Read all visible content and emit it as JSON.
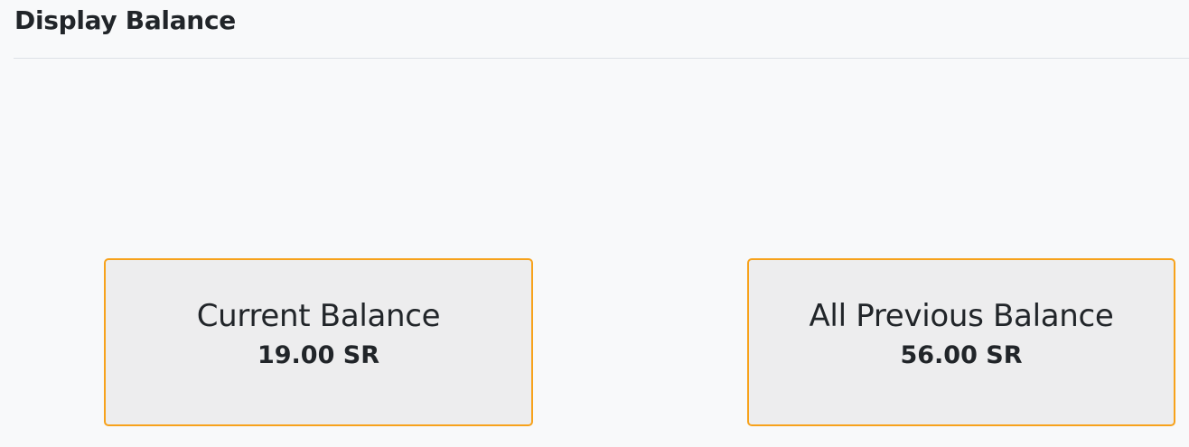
{
  "header": {
    "title": "Display Balance"
  },
  "cards": [
    {
      "label": "Current Balance",
      "value": "19.00 SR"
    },
    {
      "label": "All Previous Balance",
      "value": "56.00 SR"
    }
  ],
  "colors": {
    "accent_border": "#f7a21b",
    "card_bg": "#ededee",
    "page_bg": "#f8f9fa"
  }
}
